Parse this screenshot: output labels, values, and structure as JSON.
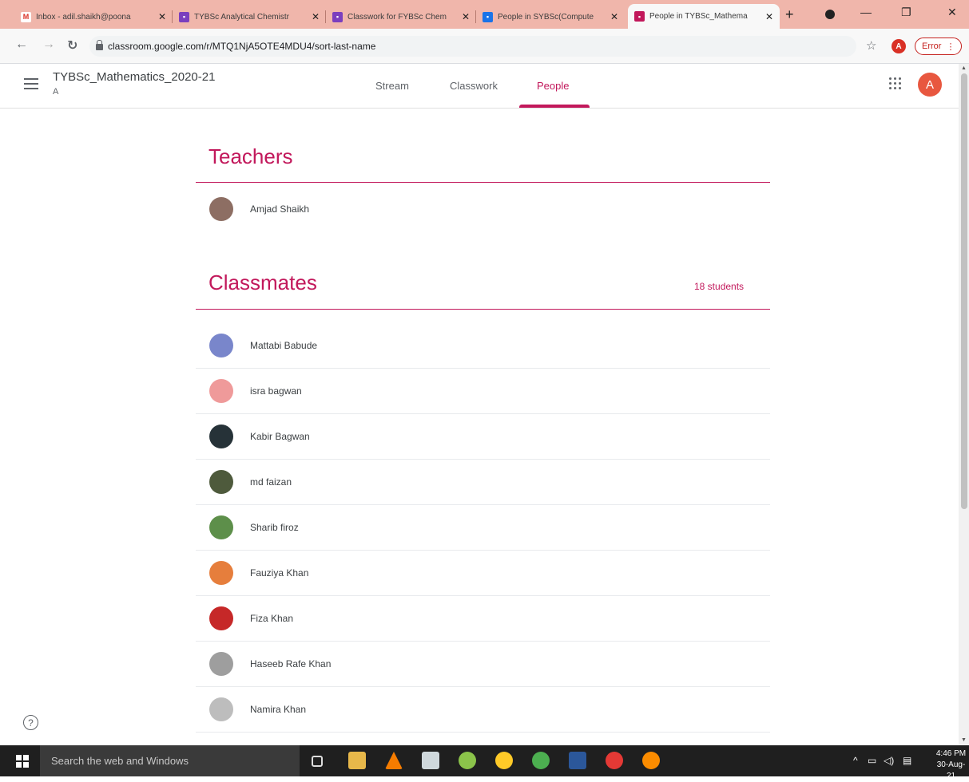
{
  "browser": {
    "tabs": [
      {
        "title": "Inbox - adil.shaikh@poona",
        "favicon": "gmail-icon",
        "active": false
      },
      {
        "title": "TYBSc Analytical Chemistr",
        "favicon": "classroom-icon",
        "active": false
      },
      {
        "title": "Classwork for FYBSc Chem",
        "favicon": "classroom-icon",
        "active": false
      },
      {
        "title": "People in SYBSc(Compute",
        "favicon": "classroom-icon",
        "active": false
      },
      {
        "title": "People in TYBSc_Mathema",
        "favicon": "classroom-icon",
        "active": true
      }
    ],
    "url": "classroom.google.com/r/MTQ1NjA5OTE4MDU4/sort-last-name",
    "profile_initial": "A",
    "error_label": "Error"
  },
  "header": {
    "class_title": "TYBSc_Mathematics_2020-21",
    "class_section": "A",
    "nav_tabs": [
      "Stream",
      "Classwork",
      "People"
    ],
    "active_tab": "People",
    "account_initial": "A"
  },
  "teachers": {
    "title": "Teachers",
    "people": [
      {
        "name": "Amjad Shaikh",
        "avatar_color": "#8d6e63"
      }
    ]
  },
  "classmates": {
    "title": "Classmates",
    "count_label": "18 students",
    "people": [
      {
        "name": "Mattabi Babude",
        "avatar_color": "#7986cb"
      },
      {
        "name": "isra bagwan",
        "avatar_color": "#ef9a9a"
      },
      {
        "name": "Kabir Bagwan",
        "avatar_color": "#263238"
      },
      {
        "name": "md faizan",
        "avatar_color": "#4e5a3c"
      },
      {
        "name": "Sharib firoz",
        "avatar_color": "#5d8f4a"
      },
      {
        "name": "Fauziya Khan",
        "avatar_color": "#e67e3c"
      },
      {
        "name": "Fiza Khan",
        "avatar_color": "#c62828"
      },
      {
        "name": "Haseeb Rafe Khan",
        "avatar_color": "#9e9e9e"
      },
      {
        "name": "Namira Khan",
        "avatar_color": "#bdbdbd"
      }
    ]
  },
  "taskbar": {
    "search_placeholder": "Search the web and Windows",
    "time": "4:46 PM",
    "date": "30-Aug-21"
  }
}
